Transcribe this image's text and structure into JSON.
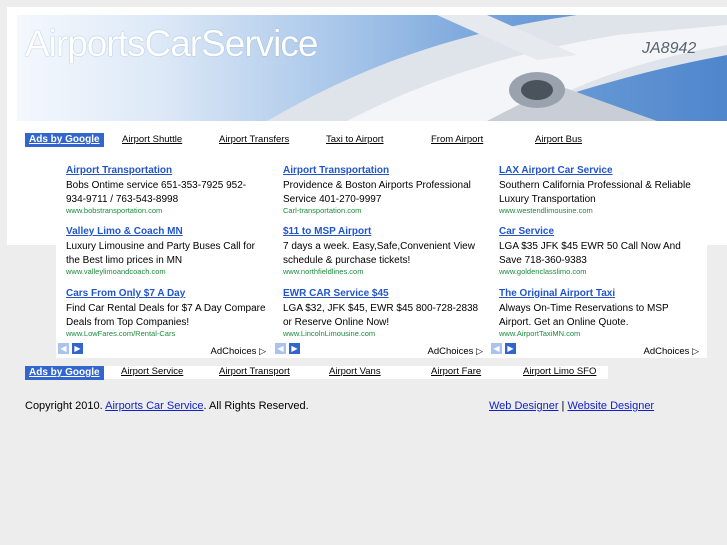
{
  "site": {
    "title": "AirportsCarService"
  },
  "top_links": {
    "ads_label": "Ads by Google",
    "items": [
      "Airport Shuttle",
      "Airport Transfers",
      "Taxi to Airport",
      "From Airport",
      "Airport Bus"
    ]
  },
  "ad_columns": [
    {
      "ads": [
        {
          "title": "Airport Transportation",
          "desc": "Bobs Ontime service 651-353-7925 952-934-9711 / 763-543-8998",
          "url": "www.bobstransportation.com"
        },
        {
          "title": "Valley Limo & Coach MN",
          "desc": "Luxury Limousine and Party Buses Call for the Best limo prices in MN",
          "url": "www.valleylimoandcoach.com"
        },
        {
          "title": "Cars From Only $7 A Day",
          "desc": "Find Car Rental Deals for $7 A Day Compare Deals from Top Companies!",
          "url": "www.LowFares.com/Rental-Cars"
        }
      ],
      "adchoices": "AdChoices"
    },
    {
      "ads": [
        {
          "title": "Airport Transportation",
          "desc": "Providence & Boston Airports Professional Service 401-270-9997",
          "url": "Carl-transportation.com"
        },
        {
          "title": "$11 to MSP Airport",
          "desc": "7 days a week. Easy,Safe,Convenient View schedule & purchase tickets!",
          "url": "www.northfieldlines.com"
        },
        {
          "title": "EWR CAR Service $45",
          "desc": "LGA $32, JFK $45, EWR $45 800-728-2838 or Reserve Online Now!",
          "url": "www.LincolnLimousine.com"
        }
      ],
      "adchoices": "AdChoices"
    },
    {
      "ads": [
        {
          "title": "LAX Airport Car Service",
          "desc": "Southern California Professional & Reliable Luxury Transportation",
          "url": "www.westendlimousine.com"
        },
        {
          "title": "Car Service",
          "desc": "LGA $35 JFK $45 EWR 50 Call Now And Save 718-360-9383",
          "url": "www.goldenclasslimo.com"
        },
        {
          "title": "The Original Airport Taxi",
          "desc": "Always On-Time Reservations to MSP Airport. Get an Online Quote.",
          "url": "www.AirportTaxiMN.com"
        }
      ],
      "adchoices": "AdChoices"
    }
  ],
  "bottom_links": {
    "ads_label": "Ads by Google",
    "items": [
      "Airport Service",
      "Airport Transport",
      "Airport Vans",
      "Airport Fare",
      "Airport Limo SFO"
    ]
  },
  "footer": {
    "copyright_prefix": "Copyright 2010. ",
    "site_link": "Airports Car Service",
    "copyright_suffix": ". All Rights Reserved.",
    "web_designer": "Web Designer",
    "separator": " | ",
    "website_designer": "Website Designer"
  },
  "colors": {
    "ad_title": "#2255cc",
    "ad_url": "#1a8c3a",
    "ads_badge": "#3366cc",
    "page_bg": "#ededed"
  }
}
